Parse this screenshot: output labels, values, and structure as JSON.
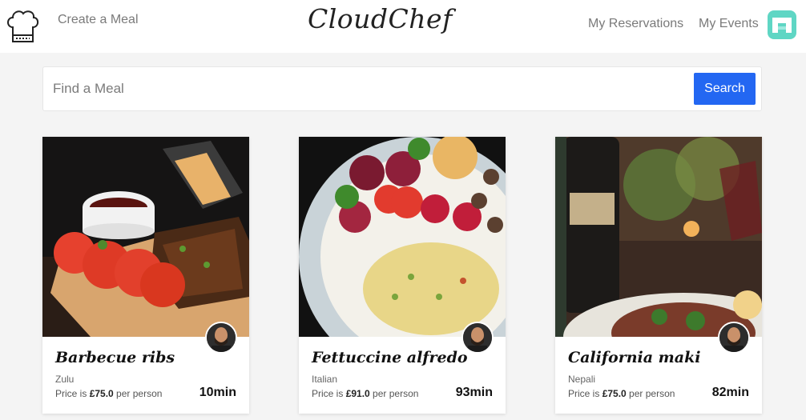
{
  "nav": {
    "create_meal": "Create a Meal",
    "brand": "CloudChef",
    "my_reservations": "My Reservations",
    "my_events": "My Events"
  },
  "search": {
    "placeholder": "Find a Meal",
    "button_label": "Search"
  },
  "colors": {
    "accent": "#2367f2",
    "avatar_bg": "#5fd6c4",
    "page_bg": "#f4f4f4"
  },
  "meals": [
    {
      "name": "Barbecue ribs",
      "cuisine": "Zulu",
      "price_prefix": "Price is ",
      "price": "£75.0",
      "price_suffix": " per person",
      "duration": "10min"
    },
    {
      "name": "Fettuccine alfredo",
      "cuisine": "Italian",
      "price_prefix": "Price is ",
      "price": "£91.0",
      "price_suffix": " per person",
      "duration": "93min"
    },
    {
      "name": "California maki",
      "cuisine": "Nepali",
      "price_prefix": "Price is ",
      "price": "£75.0",
      "price_suffix": " per person",
      "duration": "82min"
    }
  ]
}
